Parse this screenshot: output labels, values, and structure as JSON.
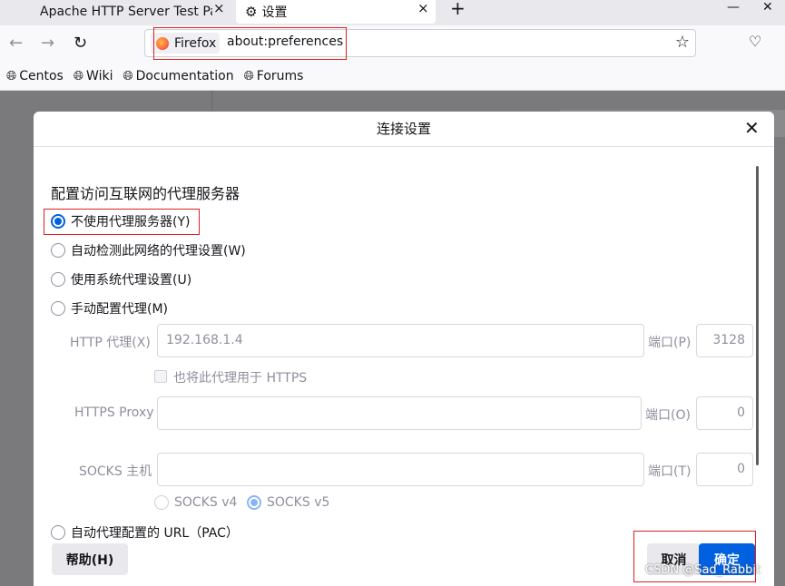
{
  "tabs": [
    {
      "label": "Apache HTTP Server Test Pag",
      "close": "×"
    },
    {
      "label": "设置",
      "close": "×"
    }
  ],
  "new_tab": "+",
  "window_controls": {
    "minimize": "—",
    "close": "✕"
  },
  "urlbar": {
    "identity": "Firefox",
    "url": "about:preferences"
  },
  "bookmarks": [
    "Centos",
    "Wiki",
    "Documentation",
    "Forums"
  ],
  "dialog": {
    "title": "连接设置",
    "heading": "配置访问互联网的代理服务器",
    "options": {
      "no_proxy": "不使用代理服务器(Y)",
      "auto_detect": "自动检测此网络的代理设置(W)",
      "system": "使用系统代理设置(U)",
      "manual": "手动配置代理(M)",
      "pac": "自动代理配置的 URL（PAC）"
    },
    "http_label": "HTTP 代理(X)",
    "http_value": "192.168.1.4",
    "http_port_label": "端口(P)",
    "http_port_value": "3128",
    "also_https": "也将此代理用于 HTTPS",
    "https_label": "HTTPS Proxy",
    "https_port_label": "端口(O)",
    "https_port_value": "0",
    "socks_label": "SOCKS 主机",
    "socks_port_label": "端口(T)",
    "socks_port_value": "0",
    "socks_v4": "SOCKS v4",
    "socks_v5": "SOCKS v5",
    "help_button": "帮助(H)",
    "cancel_button": "取消",
    "ok_button": "确定"
  },
  "watermark": "CSDN @Sad_Rabbit",
  "colors": {
    "accent": "#0061e0",
    "highlight": "#e02020"
  }
}
